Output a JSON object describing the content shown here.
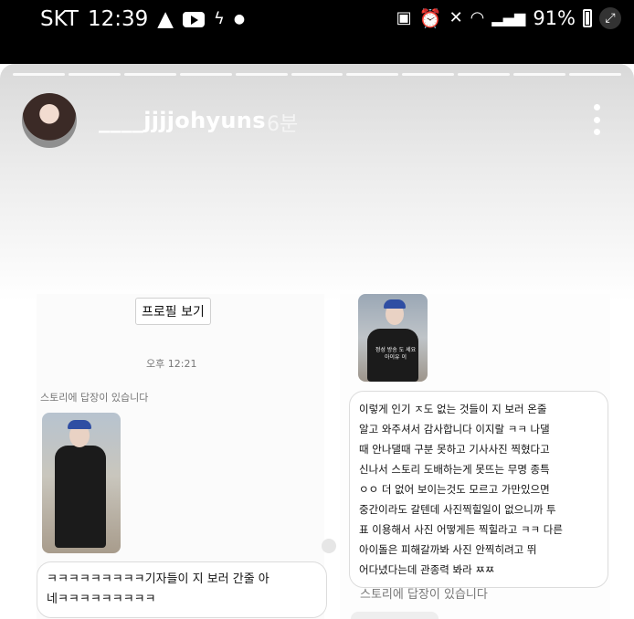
{
  "status_bar": {
    "carrier": "SKT",
    "time": "12:39",
    "left_icons": [
      "warning-icon",
      "youtube-icon",
      "bolt-icon",
      "dot-icon"
    ],
    "right_icons": [
      "sim-icon",
      "alarm-icon",
      "mute-icon",
      "wifi-icon",
      "signal-icon",
      "battery-icon",
      "expand-icon"
    ],
    "battery": "91%"
  },
  "story": {
    "segments": 11,
    "username": "____jjjjohyuns",
    "time_ago": "6분"
  },
  "dm_left": {
    "profile_button": "프로필 보기",
    "time": "오후 12:21",
    "reply_note": "스토리에 답장이 있습니다",
    "message": "ㅋㅋㅋㅋㅋㅋㅋㅋㅋ기자들이 지 보러 간줄 아\n네ㅋㅋㅋㅋㅋㅋㅋㅋㅋ"
  },
  "dm_right": {
    "thumb_caption": "정성 방송 도 세요 아이유 이",
    "message": "이렇게 인기 ㅈ도 없는 것들이 지 보러 온줄\n알고 와주셔서 감사합니다 이지랄 ㅋㅋ 나댈\n때 안나댈때 구분 못하고 기사사진 찍혔다고\n신나서 스토리 도배하는게 못뜨는 무명 종특\nㅇㅇ 더 없어 보이는것도 모르고 가만있으면\n중간이라도 갈텐데 사진찍힐일이 없으니까 투\n표 이용해서 사진 어떻게든 찍힐라고 ㅋㅋ 다른\n아이돌은 피해갈까봐 사진 안찍히려고 뛰\n어다녔다는데 관종력 봐라 ㅉㅉ",
    "reply_note": "스토리에 답장이 있습니다"
  }
}
